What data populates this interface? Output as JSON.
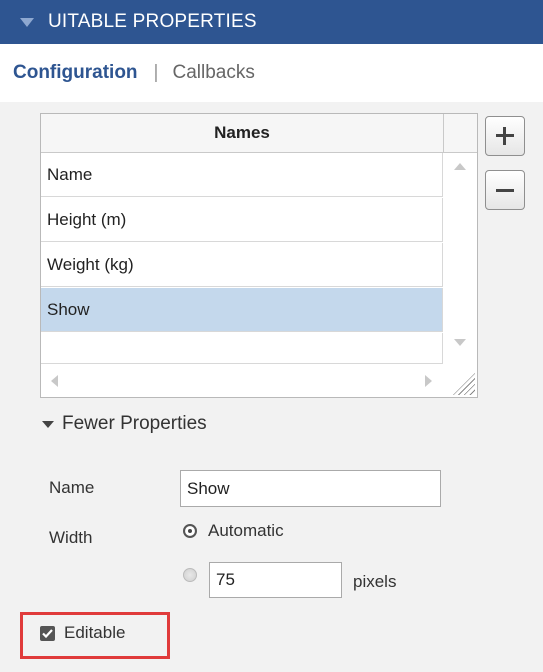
{
  "panel": {
    "title": "UITABLE PROPERTIES"
  },
  "tabs": {
    "configuration": "Configuration",
    "separator": "|",
    "callbacks": "Callbacks"
  },
  "table": {
    "column_header": "Names",
    "rows": [
      "Name",
      "Height (m)",
      "Weight (kg)",
      "Show"
    ],
    "selected_row": "Show"
  },
  "buttons": {
    "add": "+",
    "remove": "−"
  },
  "fewer_properties": {
    "label": "Fewer Properties"
  },
  "fields": {
    "name_label": "Name",
    "name_value": "Show",
    "width_label": "Width",
    "automatic_label": "Automatic",
    "pixels_value": "75",
    "pixels_unit": "pixels"
  },
  "editable": {
    "label": "Editable",
    "checked": true
  },
  "colors": {
    "header_bg": "#2e5591",
    "selection": "#c4d8ec",
    "highlight_border": "#e03b3b"
  },
  "icons": [
    "collapse-triangle-icon",
    "add-icon",
    "remove-icon",
    "scroll-up-icon",
    "scroll-down-icon",
    "scroll-left-icon",
    "scroll-right-icon",
    "resize-grip-icon",
    "expand-triangle-icon",
    "radio-icon",
    "checkbox-icon"
  ]
}
